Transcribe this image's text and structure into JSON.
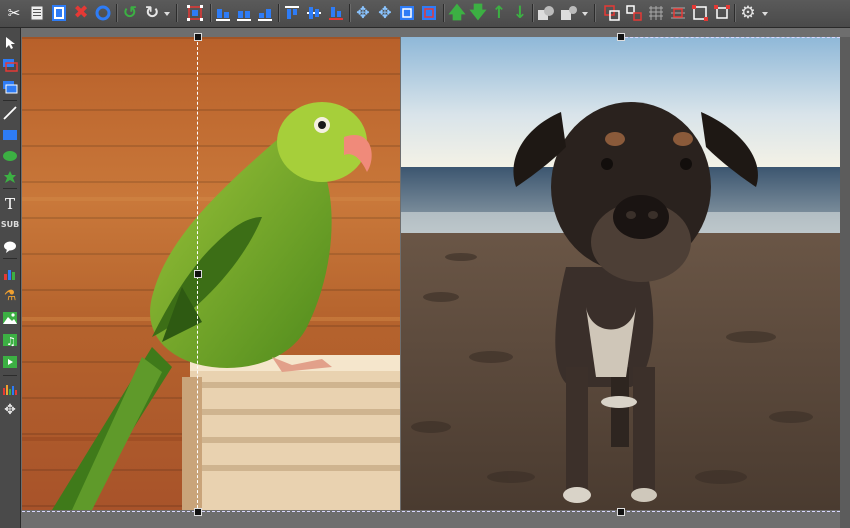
{
  "toolbar": {
    "groups": [
      {
        "id": "edit",
        "icons": [
          "cut-icon",
          "copy-icon",
          "paste-icon",
          "delete-icon",
          "deselect-icon"
        ]
      },
      {
        "id": "history",
        "icons": [
          "undo-icon",
          "redo-icon"
        ]
      },
      {
        "id": "select",
        "icons": [
          "select-all-icon"
        ]
      },
      {
        "id": "align-h",
        "icons": [
          "align-left-icon",
          "align-center-h-icon",
          "align-right-icon"
        ]
      },
      {
        "id": "align-v",
        "icons": [
          "align-top-icon",
          "align-middle-icon",
          "align-bottom-icon"
        ]
      },
      {
        "id": "size",
        "icons": [
          "same-width-icon",
          "same-height-icon",
          "same-size-icon",
          "fit-icon"
        ]
      },
      {
        "id": "order",
        "icons": [
          "bring-front-icon",
          "send-back-icon",
          "move-up-icon",
          "move-down-icon"
        ]
      },
      {
        "id": "group",
        "icons": [
          "group-icon",
          "ungroup-icon"
        ]
      },
      {
        "id": "grid",
        "icons": [
          "frame-a-icon",
          "frame-b-icon",
          "grid-icon",
          "grid-red-icon",
          "resize-icon",
          "crop-icon"
        ]
      },
      {
        "id": "settings",
        "icons": [
          "gear-icon"
        ]
      }
    ],
    "colors": {
      "accent": "#2e7cf6",
      "danger": "#e53935",
      "success": "#3cb043",
      "icon": "#e6e6e6"
    }
  },
  "leftbar": {
    "tools": [
      "pointer-icon",
      "layer-a-icon",
      "layer-b-icon",
      "line-icon",
      "rectangle-icon",
      "ellipse-icon",
      "shape-icon",
      "text-icon",
      "subtitle-icon",
      "callout-icon",
      "chart-icon",
      "figure-icon",
      "image-icon",
      "music-icon",
      "video-icon",
      "equalizer-icon",
      "move-icon"
    ],
    "text_tool_label": "T",
    "subtitle_tool_label": "SUB"
  },
  "canvas": {
    "left_image": "parrot",
    "right_image": "dog-on-beach"
  }
}
